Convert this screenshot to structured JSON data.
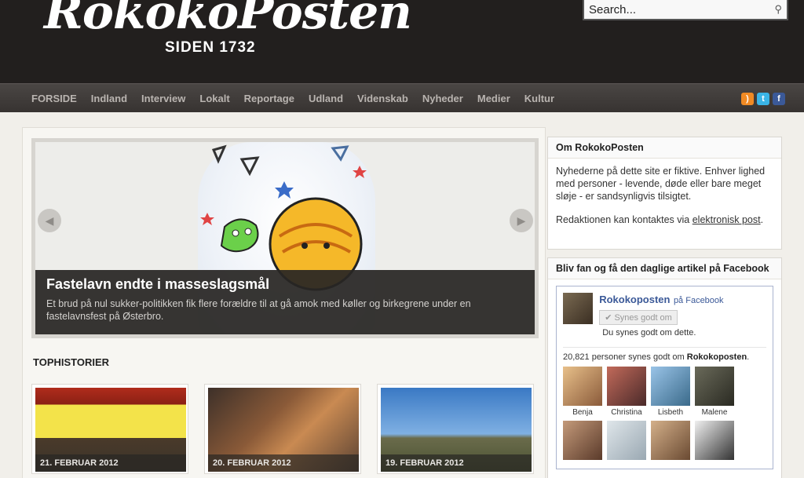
{
  "header": {
    "logo_text": "RokokoPosten",
    "logo_sub": "SIDEN 1732",
    "search_placeholder": "Search..."
  },
  "nav": {
    "items": [
      "FORSIDE",
      "Indland",
      "Interview",
      "Lokalt",
      "Reportage",
      "Udland",
      "Videnskab",
      "Nyheder",
      "Medier",
      "Kultur"
    ],
    "social_icons": [
      "rss-icon",
      "twitter-icon",
      "facebook-icon"
    ]
  },
  "slider": {
    "headline": "Fastelavn endte i masseslagsmål",
    "summary": "Et brud på nul sukker-politikken fik flere forældre til at gå amok med køller og birkegrene under en fastelavnsfest på Østerbro."
  },
  "top_stories": {
    "title": "TOPHISTORIER",
    "cards": [
      {
        "date": "21. FEBRUAR 2012"
      },
      {
        "date": "20. FEBRUAR 2012"
      },
      {
        "date": "19. FEBRUAR 2012"
      }
    ]
  },
  "sidebar": {
    "about": {
      "title": "Om RokokoPosten",
      "text1": "Nyhederne på dette site er fiktive. Enhver lighed med personer - levende, døde eller bare meget sløje - er sandsynligvis tilsigtet.",
      "text2_prefix": "Redaktionen kan kontaktes via ",
      "text2_link": "elektronisk post",
      "text2_suffix": "."
    },
    "facebook": {
      "title": "Bliv fan og få den daglige artikel på Facebook",
      "page_name": "Rokokoposten",
      "page_suffix": "på Facebook",
      "like_button": "✔ Synes godt om",
      "like_caption": "Du synes godt om dette.",
      "count_prefix": "20,821 personer synes godt om ",
      "count_name": "Rokokoposten",
      "count_suffix": ".",
      "faces": [
        "Benja",
        "Christina",
        "Lisbeth",
        "Malene"
      ]
    }
  }
}
